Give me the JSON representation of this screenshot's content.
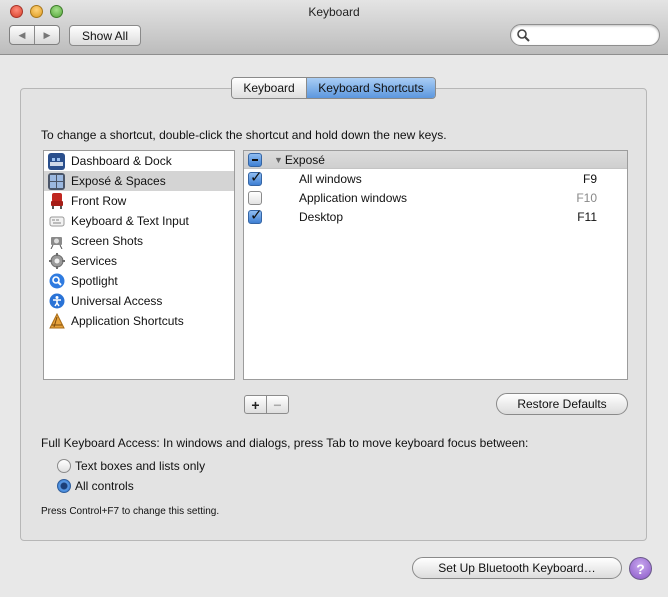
{
  "window": {
    "title": "Keyboard"
  },
  "toolbar": {
    "back": "◀",
    "forward": "▶",
    "show_all": "Show All",
    "search_placeholder": ""
  },
  "tabs": [
    {
      "label": "Keyboard",
      "selected": false
    },
    {
      "label": "Keyboard Shortcuts",
      "selected": true
    }
  ],
  "instructions": "To change a shortcut, double-click the shortcut and hold down the new keys.",
  "categories": [
    {
      "label": "Dashboard & Dock",
      "icon": "dashboard-dock-icon"
    },
    {
      "label": "Exposé & Spaces",
      "icon": "expose-spaces-icon"
    },
    {
      "label": "Front Row",
      "icon": "front-row-icon"
    },
    {
      "label": "Keyboard & Text Input",
      "icon": "keyboard-text-icon"
    },
    {
      "label": "Screen Shots",
      "icon": "screen-shots-icon"
    },
    {
      "label": "Services",
      "icon": "services-gear-icon"
    },
    {
      "label": "Spotlight",
      "icon": "spotlight-icon"
    },
    {
      "label": "Universal Access",
      "icon": "universal-access-icon"
    },
    {
      "label": "Application Shortcuts",
      "icon": "application-shortcuts-icon"
    }
  ],
  "selected_category": "Exposé & Spaces",
  "shortcuts": {
    "group": "Exposé",
    "rows": [
      {
        "label": "All windows",
        "key": "F9",
        "checked": true
      },
      {
        "label": "Application windows",
        "key": "F10",
        "checked": false
      },
      {
        "label": "Desktop",
        "key": "F11",
        "checked": true
      }
    ]
  },
  "buttons": {
    "add": "+",
    "remove": "−",
    "restore_defaults": "Restore Defaults",
    "bluetooth": "Set Up Bluetooth Keyboard…",
    "help": "?"
  },
  "full_keyboard_access": {
    "label": "Full Keyboard Access: In windows and dialogs, press Tab to move keyboard focus between:",
    "options": [
      {
        "label": "Text boxes and lists only",
        "selected": false
      },
      {
        "label": "All controls",
        "selected": true
      }
    ],
    "hint": "Press Control+F7 to change this setting."
  },
  "colors": {
    "accent": "#5c97de",
    "purple_help": "#8a57c8"
  }
}
